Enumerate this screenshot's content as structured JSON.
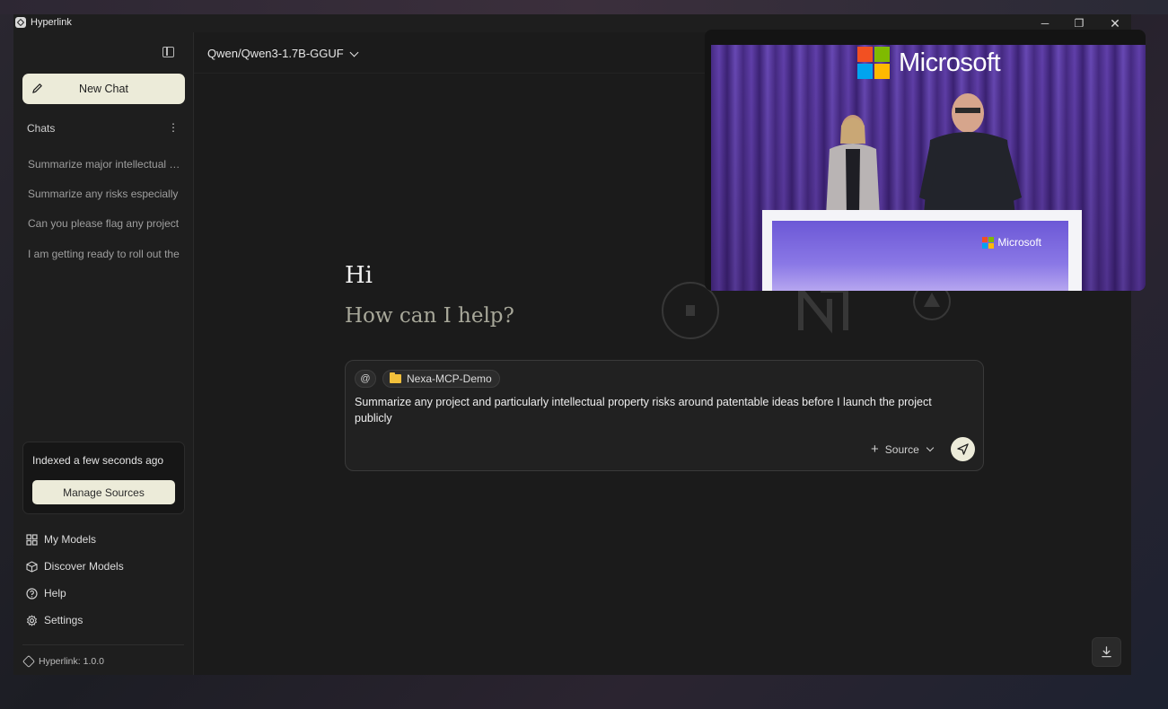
{
  "window": {
    "title": "Hyperlink",
    "controls": {
      "minimize": "─",
      "maximize": "❐",
      "close": "✕"
    }
  },
  "sidebar": {
    "new_chat_label": "New Chat",
    "chats_header": "Chats",
    "chats": [
      "Summarize major intellectual property risks",
      "Summarize any risks especially",
      "Can you please flag any project",
      "I am getting ready to roll out the"
    ],
    "indexed_status": "Indexed a few seconds ago",
    "manage_sources_label": "Manage Sources",
    "nav": [
      {
        "label": "My Models",
        "icon": "grid-icon"
      },
      {
        "label": "Discover Models",
        "icon": "cube-icon"
      },
      {
        "label": "Help",
        "icon": "help-circle-icon"
      },
      {
        "label": "Settings",
        "icon": "gear-icon"
      }
    ],
    "version": "Hyperlink: 1.0.0"
  },
  "header": {
    "model": "Qwen/Qwen3-1.7B-GGUF"
  },
  "main": {
    "greeting": "Hi",
    "subgreeting": "How can I help?"
  },
  "composer": {
    "mention_symbol": "@",
    "folder_chip": "Nexa-MCP-Demo",
    "prompt": "Summarize any project and particularly intellectual property risks around patentable ideas before I launch the project publicly",
    "source_label": "Source"
  },
  "video_overlay": {
    "brand": "Microsoft",
    "podium_brand": "Microsoft"
  },
  "colors": {
    "accent_button": "#ecebd9",
    "folder": "#f2c03b",
    "ms_red": "#f25022",
    "ms_green": "#7fba00",
    "ms_blue": "#00a4ef",
    "ms_yellow": "#ffb900"
  }
}
